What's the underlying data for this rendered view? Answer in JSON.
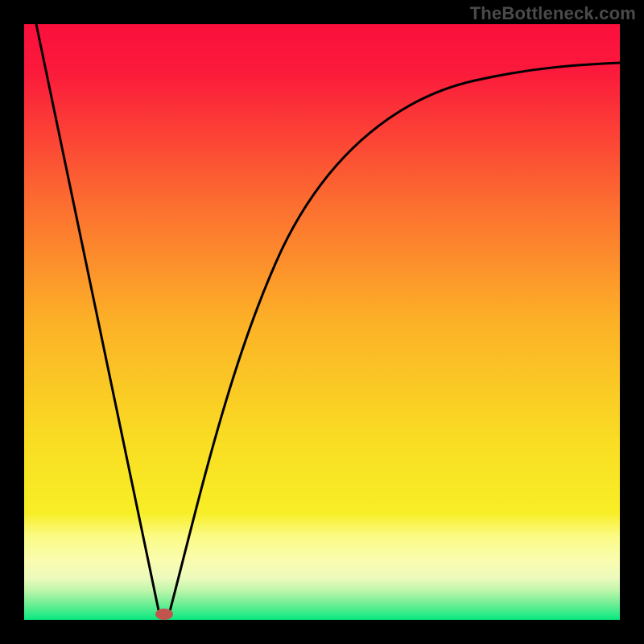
{
  "watermark": "TheBottleneck.com",
  "chart_data": {
    "type": "line",
    "title": "",
    "xlabel": "",
    "ylabel": "",
    "xlim": [
      0,
      100
    ],
    "ylim": [
      0,
      100
    ],
    "grid": false,
    "series": [
      {
        "name": "bottleneck-curve",
        "x": [
          0,
          5,
          10,
          15,
          20,
          23,
          25,
          27,
          30,
          35,
          40,
          45,
          50,
          55,
          60,
          65,
          70,
          75,
          80,
          85,
          90,
          95,
          100
        ],
        "y": [
          100,
          78.3,
          56.5,
          34.8,
          13.0,
          0,
          8.0,
          16.0,
          27.0,
          42.0,
          53.0,
          62.0,
          69.0,
          74.5,
          79.0,
          82.5,
          85.0,
          87.0,
          88.5,
          90.0,
          91.0,
          91.8,
          92.5
        ]
      }
    ],
    "marker": {
      "name": "optimal-point",
      "x": 23.5,
      "y": 0.5,
      "color": "#c1554d"
    },
    "background_gradient": {
      "top": "#fb0f3c",
      "mid1": "#fd8b2a",
      "mid2": "#f7e822",
      "band": "#fbfb86",
      "bottom": "#09e880"
    }
  }
}
